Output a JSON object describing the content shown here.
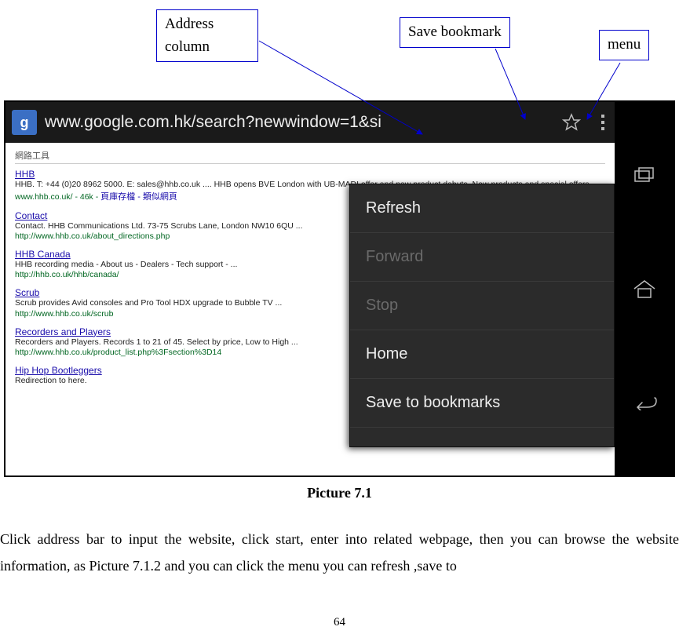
{
  "callouts": {
    "address": "Address column",
    "bookmark": "Save bookmark",
    "menu": "menu"
  },
  "browser": {
    "app_badge": "g",
    "url": "www.google.com.hk/search?newwindow=1&si"
  },
  "page": {
    "heading": "網路工具",
    "results": [
      {
        "title": "HHB",
        "snippet": "HHB. T: +44 (0)20 8962 5000. E: sales@hhb.co.uk .... HHB opens BVE London with UB-MADI offer and new product debuts. New products and special offers ...",
        "url": "www.hhb.co.uk/ - 46k - ",
        "extra": "頁庫存檔 - 類似網頁"
      },
      {
        "title": "Contact",
        "snippet": "Contact. HHB Communications Ltd. 73-75 Scrubs Lane, London NW10 6QU ...",
        "url": "http://www.hhb.co.uk/about_directions.php"
      },
      {
        "title": "HHB Canada",
        "snippet": "HHB recording media - About us - Dealers - Tech support - ...",
        "url": "http://hhb.co.uk/hhb/canada/"
      },
      {
        "title": "Scrub",
        "snippet": "Scrub provides Avid consoles and Pro Tool HDX upgrade to Bubble TV ...",
        "url": "http://www.hhb.co.uk/scrub"
      },
      {
        "title": "Recorders and Players",
        "snippet": "Recorders and Players. Records 1 to 21 of 45. Select by price, Low to High ...",
        "url": "http://www.hhb.co.uk/product_list.php%3Fsection%3D14"
      },
      {
        "title": "Hip Hop Bootleggers",
        "snippet": "Redirection to here."
      }
    ]
  },
  "menu": {
    "items": [
      {
        "label": "Refresh",
        "enabled": true
      },
      {
        "label": "Forward",
        "enabled": false
      },
      {
        "label": "Stop",
        "enabled": false
      },
      {
        "label": "Home",
        "enabled": true
      },
      {
        "label": "Save to bookmarks",
        "enabled": true
      }
    ]
  },
  "caption": "Picture 7.1",
  "body": "Click address bar to input the website, click start, enter into related webpage, then you can browse the website information, as Picture 7.1.2 and you can click the menu you can refresh ,save to",
  "page_number": "64"
}
